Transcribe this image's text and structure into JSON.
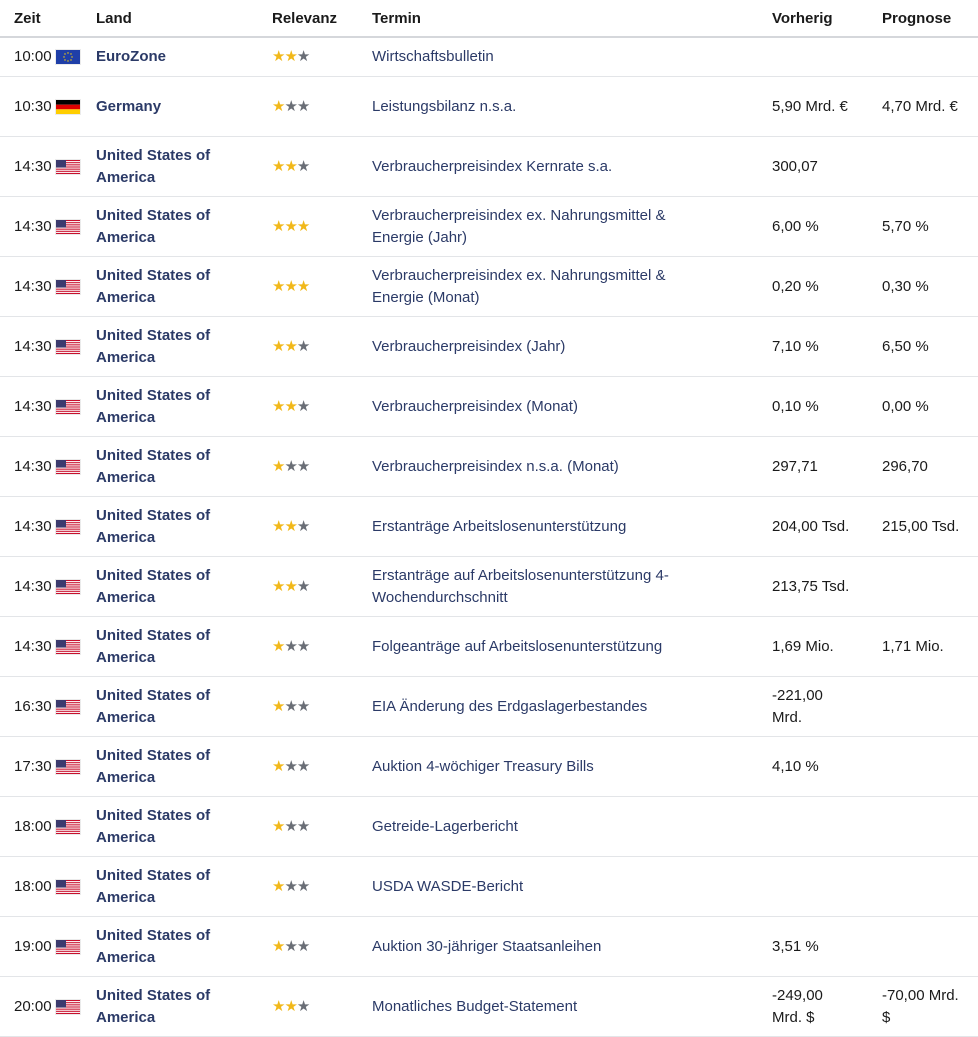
{
  "header": {
    "zeit": "Zeit",
    "land": "Land",
    "relevanz": "Relevanz",
    "termin": "Termin",
    "vorherig": "Vorherig",
    "prognose": "Prognose"
  },
  "colors": {
    "star_on": "#f1b81a",
    "star_off": "#6a6e76",
    "link": "#2b3a67"
  },
  "rows": [
    {
      "zeit": "10:00",
      "flag": "eu-flag-icon",
      "land": "EuroZone",
      "stars": 2,
      "termin": "Wirtschaftsbulletin",
      "vorherig": "",
      "prognose": ""
    },
    {
      "zeit": "10:30",
      "flag": "de-flag-icon",
      "land": "Germany",
      "stars": 1,
      "termin": "Leistungsbilanz n.s.a.",
      "vorherig": "5,90 Mrd. €",
      "prognose": "4,70 Mrd. €"
    },
    {
      "zeit": "14:30",
      "flag": "us-flag-icon",
      "land": "United States of America",
      "stars": 2,
      "termin": "Verbraucherpreisindex Kernrate s.a.",
      "vorherig": "300,07",
      "prognose": ""
    },
    {
      "zeit": "14:30",
      "flag": "us-flag-icon",
      "land": "United States of America",
      "stars": 3,
      "termin": "Verbraucherpreisindex ex. Nahrungsmittel & Energie (Jahr)",
      "vorherig": "6,00 %",
      "prognose": "5,70 %"
    },
    {
      "zeit": "14:30",
      "flag": "us-flag-icon",
      "land": "United States of America",
      "stars": 3,
      "termin": "Verbraucherpreisindex ex. Nahrungsmittel & Energie (Monat)",
      "vorherig": "0,20 %",
      "prognose": "0,30 %"
    },
    {
      "zeit": "14:30",
      "flag": "us-flag-icon",
      "land": "United States of America",
      "stars": 2,
      "termin": "Verbraucherpreisindex (Jahr)",
      "vorherig": "7,10 %",
      "prognose": "6,50 %"
    },
    {
      "zeit": "14:30",
      "flag": "us-flag-icon",
      "land": "United States of America",
      "stars": 2,
      "termin": "Verbraucherpreisindex (Monat)",
      "vorherig": "0,10 %",
      "prognose": "0,00 %"
    },
    {
      "zeit": "14:30",
      "flag": "us-flag-icon",
      "land": "United States of America",
      "stars": 1,
      "termin": "Verbraucherpreisindex n.s.a. (Monat)",
      "vorherig": "297,71",
      "prognose": "296,70"
    },
    {
      "zeit": "14:30",
      "flag": "us-flag-icon",
      "land": "United States of America",
      "stars": 2,
      "termin": "Erstanträge Arbeitslosenunterstützung",
      "vorherig": "204,00 Tsd.",
      "prognose": "215,00 Tsd."
    },
    {
      "zeit": "14:30",
      "flag": "us-flag-icon",
      "land": "United States of America",
      "stars": 2,
      "termin": "Erstanträge auf Arbeitslosenunterstützung 4-Wochendurchschnitt",
      "vorherig": "213,75 Tsd.",
      "prognose": ""
    },
    {
      "zeit": "14:30",
      "flag": "us-flag-icon",
      "land": "United States of America",
      "stars": 1,
      "termin": "Folgeanträge auf Arbeitslosenunterstützung",
      "vorherig": "1,69 Mio.",
      "prognose": "1,71 Mio."
    },
    {
      "zeit": "16:30",
      "flag": "us-flag-icon",
      "land": "United States of America",
      "stars": 1,
      "termin": "EIA Änderung des Erdgaslagerbestandes",
      "vorherig": "-221,00 Mrd.",
      "prognose": ""
    },
    {
      "zeit": "17:30",
      "flag": "us-flag-icon",
      "land": "United States of America",
      "stars": 1,
      "termin": "Auktion 4-wöchiger Treasury Bills",
      "vorherig": "4,10 %",
      "prognose": ""
    },
    {
      "zeit": "18:00",
      "flag": "us-flag-icon",
      "land": "United States of America",
      "stars": 1,
      "termin": "Getreide-Lagerbericht",
      "vorherig": "",
      "prognose": ""
    },
    {
      "zeit": "18:00",
      "flag": "us-flag-icon",
      "land": "United States of America",
      "stars": 1,
      "termin": "USDA WASDE-Bericht",
      "vorherig": "",
      "prognose": ""
    },
    {
      "zeit": "19:00",
      "flag": "us-flag-icon",
      "land": "United States of America",
      "stars": 1,
      "termin": "Auktion 30-jähriger Staatsanleihen",
      "vorherig": "3,51 %",
      "prognose": ""
    },
    {
      "zeit": "20:00",
      "flag": "us-flag-icon",
      "land": "United States of America",
      "stars": 2,
      "termin": "Monatliches Budget-Statement",
      "vorherig": "-249,00 Mrd. $",
      "prognose": "-70,00 Mrd. $"
    }
  ]
}
